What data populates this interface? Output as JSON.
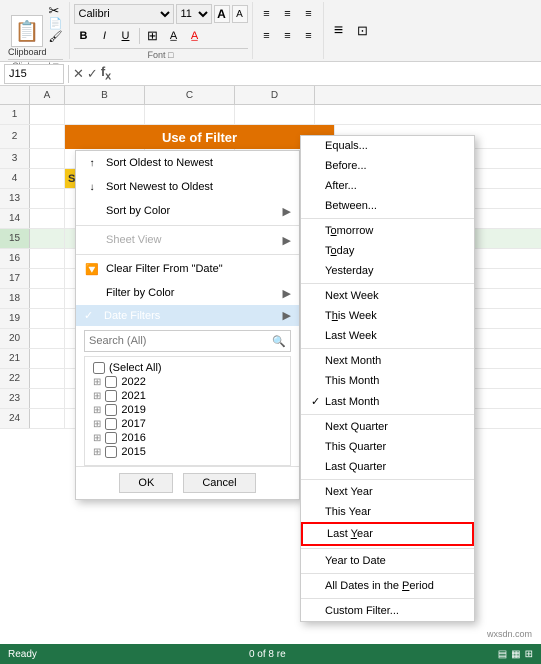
{
  "ribbon": {
    "font_name": "Calibri",
    "font_size": "11",
    "increase_font_label": "A",
    "decrease_font_label": "A",
    "bold_label": "B",
    "italic_label": "I",
    "underline_label": "U",
    "clipboard_label": "Clipboard",
    "font_label": "Font",
    "cell_ref": "J15"
  },
  "spreadsheet": {
    "title": "Use of Filter",
    "columns": [
      "A",
      "B",
      "C",
      "D"
    ],
    "rows": [
      {
        "num": "1",
        "a": "",
        "b": "",
        "c": "",
        "d": ""
      },
      {
        "num": "2",
        "a": "",
        "b": "",
        "c": "",
        "d": ""
      },
      {
        "num": "3",
        "a": "",
        "b": "",
        "c": "",
        "d": ""
      },
      {
        "num": "4",
        "a": "Sale",
        "b": "",
        "c": "",
        "d": ""
      },
      {
        "num": "13",
        "a": "",
        "b": "",
        "c": "",
        "d": ""
      },
      {
        "num": "14",
        "a": "",
        "b": "",
        "c": "",
        "d": ""
      },
      {
        "num": "15",
        "a": "",
        "b": "",
        "c": "",
        "d": ""
      },
      {
        "num": "16",
        "a": "",
        "b": "",
        "c": "",
        "d": ""
      },
      {
        "num": "17",
        "a": "",
        "b": "",
        "c": "",
        "d": ""
      },
      {
        "num": "18",
        "a": "",
        "b": "",
        "c": "",
        "d": ""
      },
      {
        "num": "19",
        "a": "",
        "b": "",
        "c": "",
        "d": ""
      },
      {
        "num": "20",
        "a": "",
        "b": "",
        "c": "",
        "d": ""
      },
      {
        "num": "21",
        "a": "",
        "b": "",
        "c": "",
        "d": ""
      },
      {
        "num": "22",
        "a": "",
        "b": "",
        "c": "",
        "d": ""
      },
      {
        "num": "23",
        "a": "",
        "b": "",
        "c": "",
        "d": ""
      },
      {
        "num": "24",
        "a": "",
        "b": "",
        "c": "",
        "d": ""
      }
    ]
  },
  "context_menu": {
    "items": [
      {
        "id": "sort-az",
        "label": "Sort Oldest to Newest",
        "icon": "↑↓",
        "has_arrow": false
      },
      {
        "id": "sort-za",
        "label": "Sort Newest to Oldest",
        "icon": "↓↑",
        "has_arrow": false
      },
      {
        "id": "sort-color",
        "label": "Sort by Color",
        "icon": "",
        "has_arrow": true
      },
      {
        "id": "sheet-view",
        "label": "Sheet View",
        "icon": "",
        "has_arrow": true,
        "disabled": true
      },
      {
        "id": "clear-filter",
        "label": "Clear Filter From \"Date\"",
        "icon": "🔽",
        "has_arrow": false
      },
      {
        "id": "filter-color",
        "label": "Filter by Color",
        "icon": "",
        "has_arrow": true
      },
      {
        "id": "date-filters",
        "label": "Date Filters",
        "icon": "",
        "has_arrow": true,
        "highlighted": true
      },
      {
        "id": "search-all",
        "label": "Search (All)",
        "icon": "",
        "is_search": true
      }
    ],
    "checklist": [
      {
        "label": "(Select All)",
        "checked": false,
        "indent": 0
      },
      {
        "label": "2022",
        "checked": false,
        "indent": 0
      },
      {
        "label": "2021",
        "checked": false,
        "indent": 0
      },
      {
        "label": "2019",
        "checked": false,
        "indent": 0
      },
      {
        "label": "2017",
        "checked": false,
        "indent": 0
      },
      {
        "label": "2016",
        "checked": false,
        "indent": 0
      },
      {
        "label": "2015",
        "checked": false,
        "indent": 0
      }
    ],
    "ok_label": "OK",
    "cancel_label": "Cancel"
  },
  "submenu": {
    "items": [
      {
        "id": "equals",
        "label": "Equals...",
        "check": ""
      },
      {
        "id": "before",
        "label": "Before...",
        "check": ""
      },
      {
        "id": "after",
        "label": "After...",
        "check": ""
      },
      {
        "id": "between",
        "label": "Between...",
        "check": ""
      },
      {
        "id": "sep1",
        "separator": true
      },
      {
        "id": "tomorrow",
        "label": "Tomorrow",
        "check": ""
      },
      {
        "id": "today",
        "label": "Today",
        "check": ""
      },
      {
        "id": "yesterday",
        "label": "Yesterday",
        "check": ""
      },
      {
        "id": "sep2",
        "separator": true
      },
      {
        "id": "next-week",
        "label": "Next Week",
        "check": ""
      },
      {
        "id": "this-week",
        "label": "This Week",
        "check": ""
      },
      {
        "id": "last-week",
        "label": "Last Week",
        "check": ""
      },
      {
        "id": "sep3",
        "separator": true
      },
      {
        "id": "next-month",
        "label": "Next Month",
        "check": ""
      },
      {
        "id": "this-month",
        "label": "This Month",
        "check": ""
      },
      {
        "id": "last-month",
        "label": "Last Month",
        "check": "✓"
      },
      {
        "id": "sep4",
        "separator": true
      },
      {
        "id": "next-quarter",
        "label": "Next Quarter",
        "check": ""
      },
      {
        "id": "this-quarter",
        "label": "This Quarter",
        "check": ""
      },
      {
        "id": "last-quarter",
        "label": "Last Quarter",
        "check": ""
      },
      {
        "id": "sep5",
        "separator": true
      },
      {
        "id": "next-year",
        "label": "Next Year",
        "check": ""
      },
      {
        "id": "this-year",
        "label": "This Year",
        "check": ""
      },
      {
        "id": "last-year",
        "label": "Last Year",
        "check": "",
        "highlight_border": true
      },
      {
        "id": "sep6",
        "separator": true
      },
      {
        "id": "year-to-date",
        "label": "Year to Date",
        "check": ""
      },
      {
        "id": "sep7",
        "separator": true
      },
      {
        "id": "all-dates",
        "label": "All Dates in the Period",
        "check": ""
      },
      {
        "id": "sep8",
        "separator": true
      },
      {
        "id": "custom",
        "label": "Custom Filter...",
        "check": ""
      }
    ]
  },
  "status_bar": {
    "ready": "Ready",
    "records": "0 of 8 re"
  },
  "watermark": "wxsdn.com"
}
